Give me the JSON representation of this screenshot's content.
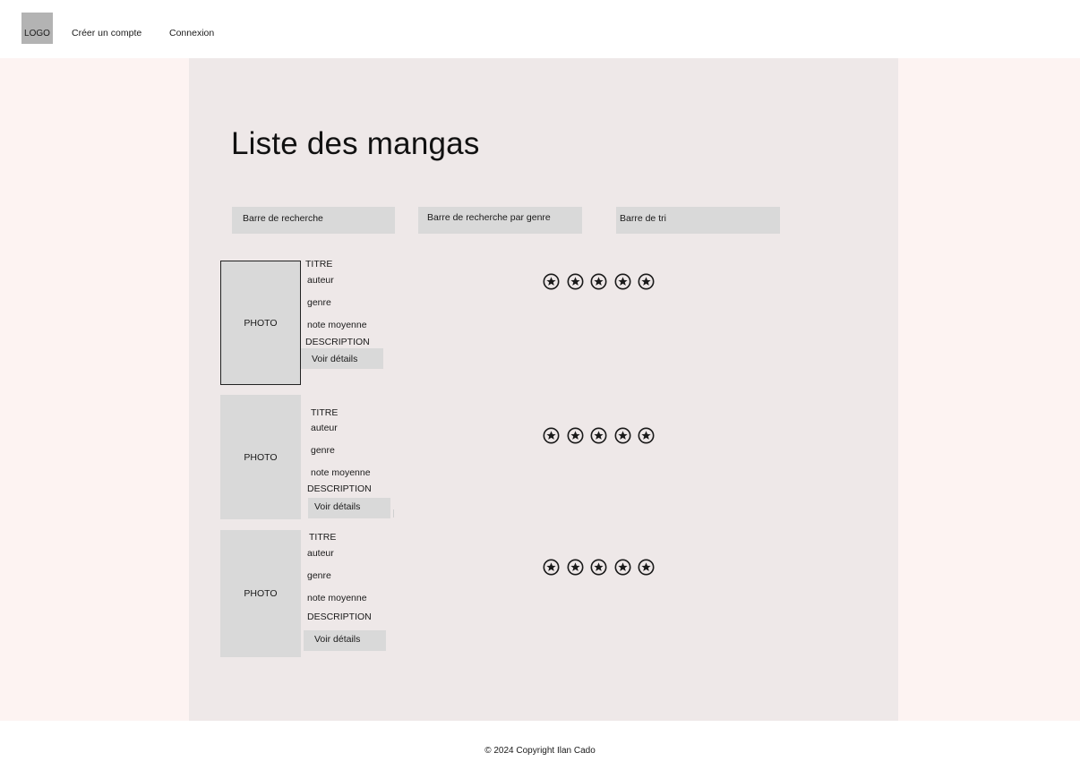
{
  "header": {
    "logo": "LOGO",
    "nav": [
      "Créer un compte",
      "Connexion"
    ]
  },
  "main": {
    "title": "Liste des mangas",
    "search_bar": "Barre de recherche",
    "genre_search_bar": "Barre de recherche par genre",
    "sort_bar": "Barre de tri"
  },
  "mangas": [
    {
      "photo": "PHOTO",
      "title": "TITRE",
      "author": "auteur",
      "genre": "genre",
      "average_rating": "note moyenne",
      "description": "DESCRIPTION",
      "details_button": "Voir détails",
      "rating_stars": 5
    },
    {
      "photo": "PHOTO",
      "title": "TITRE",
      "author": "auteur",
      "genre": "genre",
      "average_rating": "note moyenne",
      "description": "DESCRIPTION",
      "details_button": "Voir détails",
      "rating_stars": 5
    },
    {
      "photo": "PHOTO",
      "title": "TITRE",
      "author": "auteur",
      "genre": "genre",
      "average_rating": "note moyenne",
      "description": "DESCRIPTION",
      "details_button": "Voir détails",
      "rating_stars": 5
    }
  ],
  "footer": {
    "copyright": "© 2024 Copyright Ilan Cado"
  },
  "icons": {
    "star": "star-circle-icon"
  },
  "colors": {
    "band": "#fdf3f2",
    "main_panel": "#eee8e8",
    "placeholder_gray": "#d9d9d9",
    "logo_gray": "#b3b3b3"
  }
}
